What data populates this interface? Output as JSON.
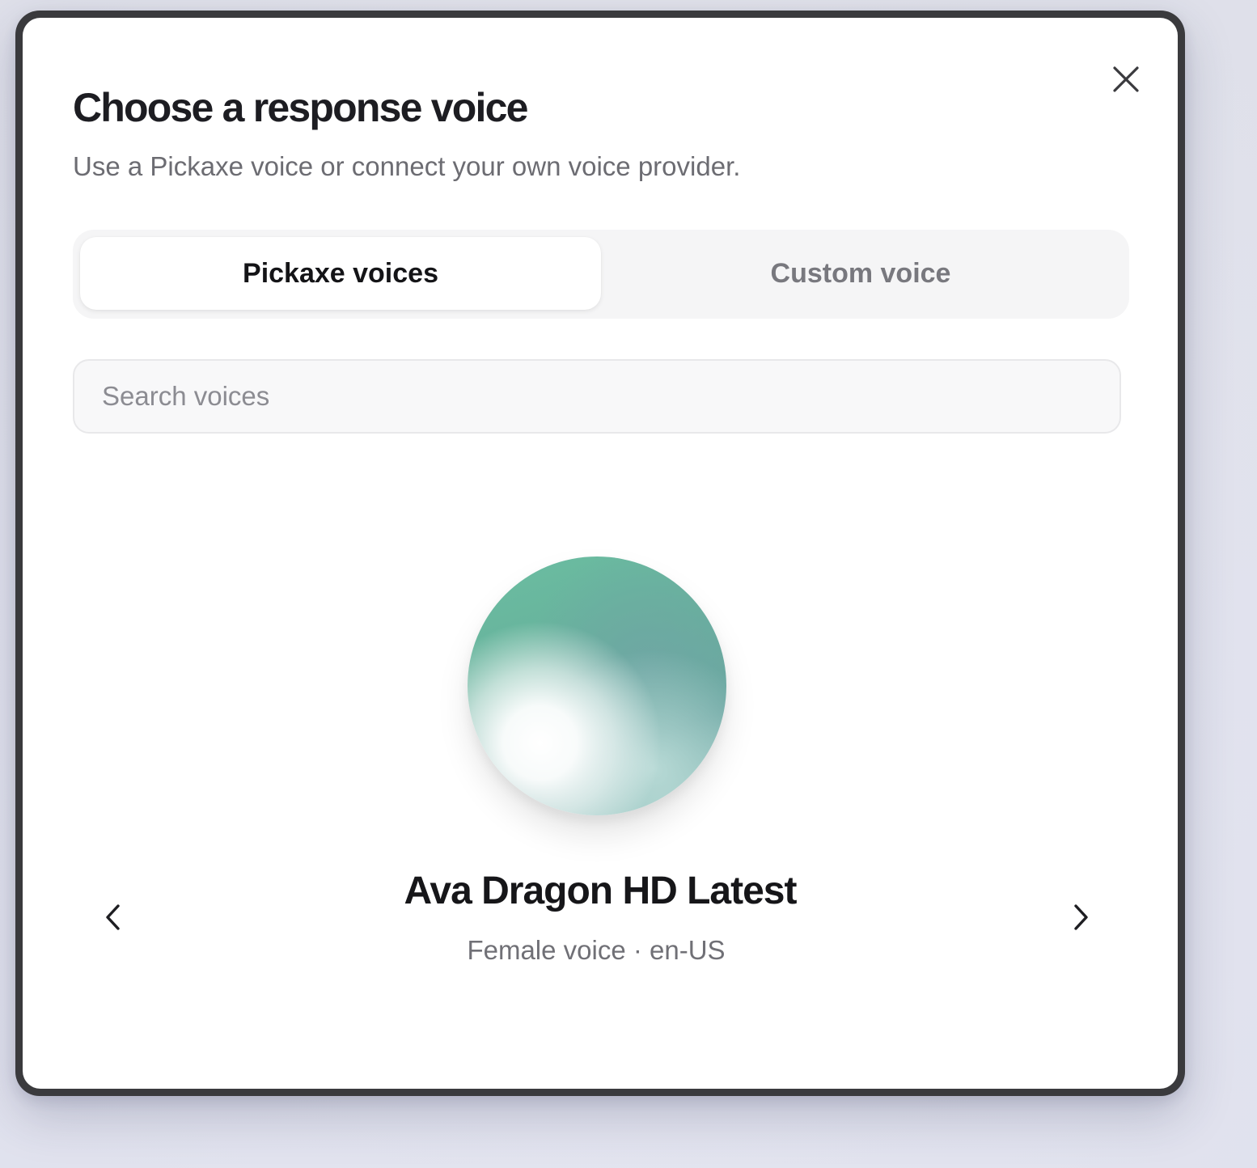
{
  "dialog": {
    "title": "Choose a response voice",
    "subtitle": "Use a Pickaxe voice or connect your own voice provider.",
    "close_icon": "close-icon"
  },
  "tabs": [
    {
      "label": "Pickaxe voices",
      "active": true
    },
    {
      "label": "Custom voice",
      "active": false
    }
  ],
  "search": {
    "placeholder": "Search voices",
    "value": ""
  },
  "voice": {
    "name": "Ava Dragon HD Latest",
    "meta": "Female voice · en-US",
    "orb_colors": [
      "#6bbea1",
      "#6fa7a4",
      "#ffffff"
    ]
  },
  "carousel": {
    "prev_icon": "chevron-left-icon",
    "next_icon": "chevron-right-icon"
  },
  "colors": {
    "accent": "#67b19c",
    "text_primary": "#161619",
    "text_secondary": "#6c6c72"
  }
}
